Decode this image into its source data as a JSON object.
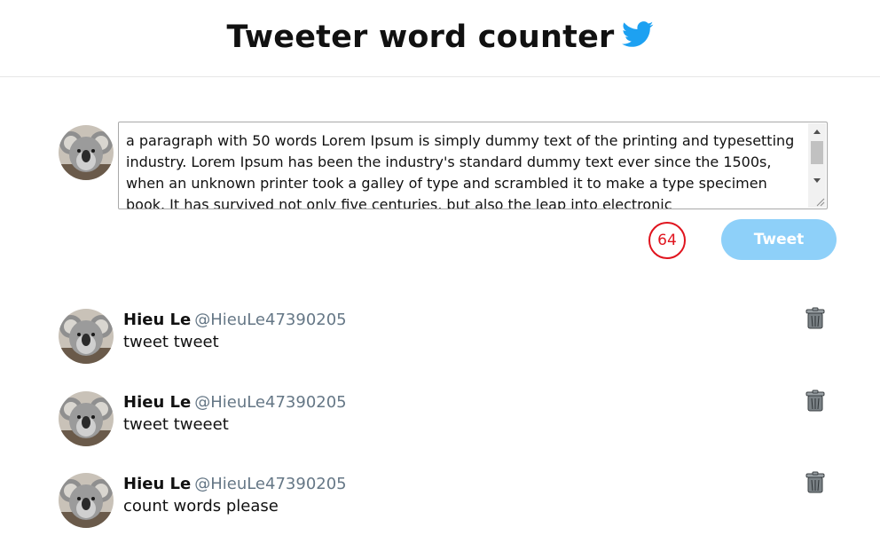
{
  "header": {
    "title": "Tweeter word counter",
    "icon": "twitter-bird-icon",
    "icon_color": "#1da1f2"
  },
  "composer": {
    "text": "a paragraph with 50 words Lorem Ipsum is simply dummy text of the printing and typesetting industry. Lorem Ipsum has been the industry's standard dummy text ever since the 1500s, when an unknown printer took a galley of type and scrambled it to make a type specimen book. It has survived not only five centuries, but also the leap into electronic",
    "word_count": "64",
    "counter_color": "#e0141e",
    "tweet_button_label": "Tweet",
    "tweet_button_color": "#8ed0f9"
  },
  "tweets": [
    {
      "name": "Hieu Le",
      "handle": "@HieuLe47390205",
      "text": "tweet tweet"
    },
    {
      "name": "Hieu Le",
      "handle": "@HieuLe47390205",
      "text": "tweet tweeet"
    },
    {
      "name": "Hieu Le",
      "handle": "@HieuLe47390205",
      "text": "count words please"
    }
  ]
}
